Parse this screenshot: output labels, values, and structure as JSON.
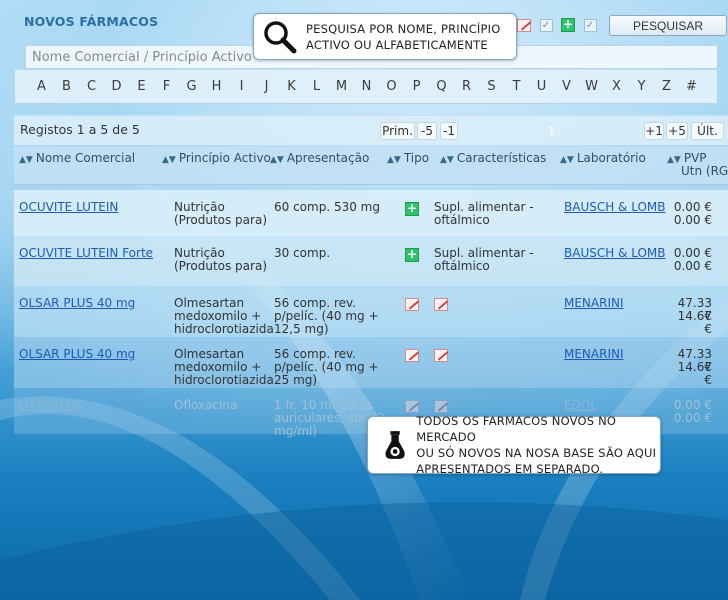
{
  "header": {
    "title": "NOVOS FÁRMACOS",
    "search_button": "PESQUISAR",
    "search_placeholder": "Nome Comercial / Princípio Activo"
  },
  "alphabet": [
    "A",
    "B",
    "C",
    "D",
    "E",
    "F",
    "G",
    "H",
    "I",
    "J",
    "K",
    "L",
    "M",
    "N",
    "O",
    "P",
    "Q",
    "R",
    "S",
    "T",
    "U",
    "V",
    "W",
    "X",
    "Y",
    "Z",
    "#"
  ],
  "callouts": {
    "search_line1": "PESQUISA POR NOME, PRINCÍPIO",
    "search_line2": "ACTIVO OU ALFABETICAMENTE",
    "new_line1": "TODOS OS FARMACOS NOVOS NO MERCADO",
    "new_line2": "OU SÓ NOVOS NA NOSA BASE SÃO AQUI",
    "new_line3": "APRESENTADOS EM SEPARADO."
  },
  "pager": {
    "records": "Registos 1 a 5 de 5",
    "first": "Prim.",
    "minus5": "-5",
    "minus1": "-1",
    "current": "1",
    "plus1": "+1",
    "plus5": "+5",
    "last": "Últ."
  },
  "columns": {
    "name": "Nome Comercial",
    "active": "Princípio Activo",
    "presentation": "Apresentação",
    "type": "Tipo",
    "features": "Características",
    "lab": "Laboratório",
    "pvp1": "PVP",
    "pvp2": "Utn (RG)"
  },
  "rows": [
    {
      "name": "OCUVITE LUTEIN",
      "active1": "Nutrição",
      "active2": "(Produtos para)",
      "active3": "",
      "pres1": "60 comp. 530 mg",
      "pres2": "",
      "pres3": "",
      "type_icon": "plus-icon",
      "feat1": "Supl. alimentar -",
      "feat2": "oftálmico",
      "lab": "BAUSCH & LOMB",
      "price1": "0.00 €",
      "price2": "0.00 €"
    },
    {
      "name": "OCUVITE LUTEIN Forte",
      "active1": "Nutrição",
      "active2": "(Produtos para)",
      "active3": "",
      "pres1": "30 comp.",
      "pres2": "",
      "pres3": "",
      "type_icon": "plus-icon",
      "feat1": "Supl. alimentar -",
      "feat2": "oftálmico",
      "lab": "BAUSCH & LOMB",
      "price1": "0.00 €",
      "price2": "0.00 €"
    },
    {
      "name": "OLSAR PLUS 40 mg",
      "active1": "Olmesartan",
      "active2": "medoxomilo +",
      "active3": "hidroclorotiazida",
      "pres1": "56 comp. rev.",
      "pres2": "p/pelíc. (40 mg +",
      "pres3": "12,5 mg)",
      "type_icon": "prescription-icon",
      "feat1": "",
      "feat2": "",
      "lab": "MENARINI",
      "price1": "47.33 €",
      "price2": "14.67 €"
    },
    {
      "name": "OLSAR PLUS 40 mg",
      "active1": "Olmesartan",
      "active2": "medoxomilo +",
      "active3": "hidroclorotiazida",
      "pres1": "56 comp. rev.",
      "pres2": "p/pelíc. (40 mg +",
      "pres3": "25 mg)",
      "type_icon": "prescription-icon",
      "feat1": "",
      "feat2": "",
      "lab": "MENARINI",
      "price1": "47.33 €",
      "price2": "14.67 €"
    },
    {
      "name": "OTTOFLOX",
      "active1": "Ofloxacina",
      "active2": "",
      "active3": "",
      "pres1": "1 fr. 10 ml gotas",
      "pres2": "auriculares, sol. (3",
      "pres3": "mg/ml)",
      "type_icon": "prescription-icon",
      "feat1": "",
      "feat2": "",
      "lab": "EDOL",
      "price1": "0.00 €",
      "price2": "0.00 €"
    }
  ]
}
